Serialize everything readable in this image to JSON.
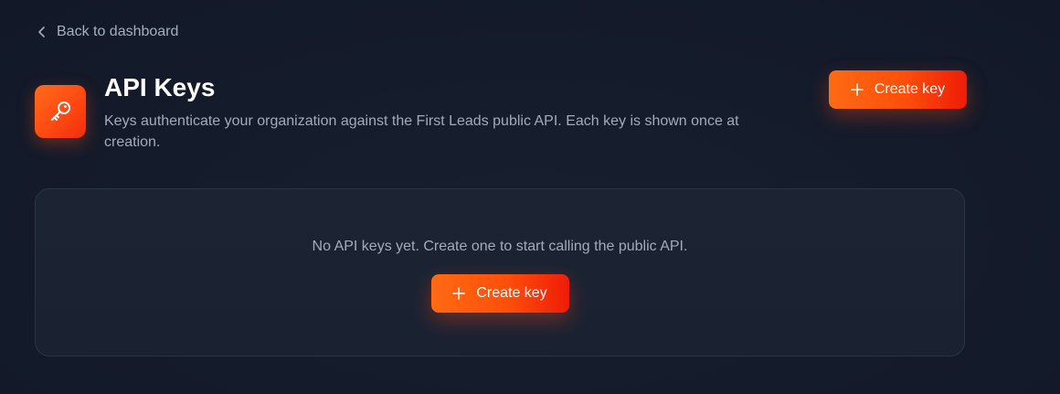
{
  "nav": {
    "back_label": "Back to dashboard",
    "back_icon": "chevron-left-icon"
  },
  "header": {
    "icon": "key-icon",
    "title": "API Keys",
    "description": "Keys authenticate your organization against the First Leads public API. Each key is shown once at creation.",
    "create_button_label": "Create key"
  },
  "empty_state": {
    "message": "No API keys yet. Create one to start calling the public API.",
    "create_button_label": "Create key"
  },
  "colors": {
    "background": "#131a2a",
    "accent_start": "#ff6a12",
    "accent_end": "#ee1c08",
    "muted_text": "#a3abba"
  }
}
